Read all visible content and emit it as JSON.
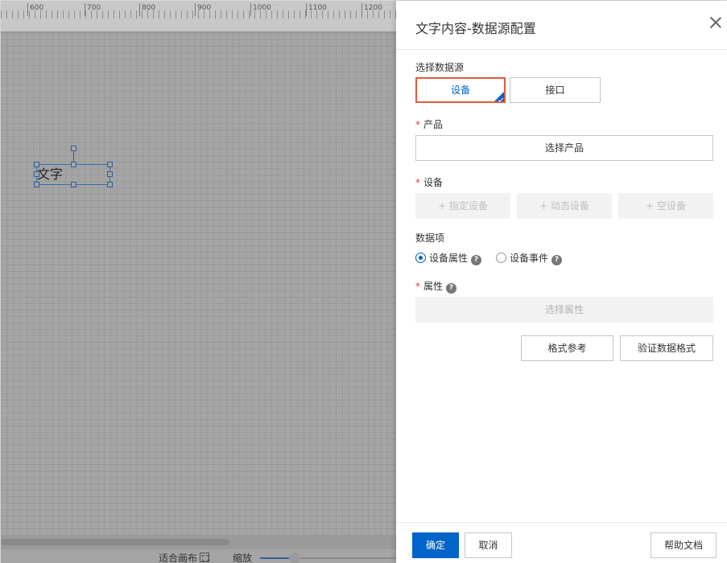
{
  "ruler": {
    "labels": [
      "600",
      "700",
      "800",
      "900",
      "1000",
      "1100",
      "1200"
    ]
  },
  "canvas": {
    "text_widget": "文字",
    "fit_canvas": "适合画布",
    "zoom": "缩放"
  },
  "drawer": {
    "title": "文字内容-数据源配置",
    "source": {
      "label": "选择数据源",
      "options": [
        "设备",
        "接口"
      ],
      "selected": "设备"
    },
    "product": {
      "required": "*",
      "label": "产品",
      "button": "选择产品"
    },
    "device": {
      "required": "*",
      "label": "设备",
      "buttons": [
        "+ 指定设备",
        "+ 动态设备",
        "+ 空设备"
      ]
    },
    "data_item": {
      "label": "数据项",
      "options": [
        "设备属性",
        "设备事件"
      ],
      "selected": "设备属性",
      "help_glyph": "?"
    },
    "attribute": {
      "required": "*",
      "label": "属性",
      "button": "选择属性"
    },
    "actions": {
      "format_ref": "格式参考",
      "verify_format": "验证数据格式"
    },
    "footer": {
      "ok": "确定",
      "cancel": "取消",
      "help_doc": "帮助文档"
    }
  },
  "colors": {
    "primary": "#0064c8",
    "highlight": "#e05a3c",
    "required": "#e4393c"
  }
}
